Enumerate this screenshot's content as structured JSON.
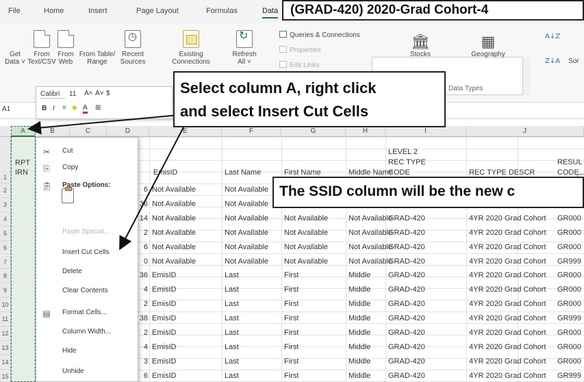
{
  "ribbon_tabs": [
    "File",
    "Home",
    "Insert",
    "Page Layout",
    "Formulas",
    "Data"
  ],
  "active_tab": "Data",
  "get_data": {
    "buttons": [
      {
        "line1": "Get",
        "line2": "Data ˅",
        "icon": "database-icon"
      },
      {
        "line1": "From",
        "line2": "Text/CSV",
        "icon": "text-file-icon"
      },
      {
        "line1": "From",
        "line2": "Web",
        "icon": "web-icon"
      },
      {
        "line1": "From Table/",
        "line2": "Range",
        "icon": "table-icon"
      },
      {
        "line1": "Recent",
        "line2": "Sources",
        "icon": "recent-icon"
      },
      {
        "line1": "Existing",
        "line2": "Connections",
        "icon": "connections-icon"
      }
    ]
  },
  "queries": {
    "refresh_line1": "Refresh",
    "refresh_line2": "All ˅",
    "queries_connections": "Queries & Connections",
    "properties": "Properties",
    "edit_links": "Edit Links"
  },
  "data_types": {
    "stocks": "Stocks",
    "geography": "Geography",
    "group_label": "Data Types"
  },
  "sort": {
    "label": "Sor",
    "az": "A↓Z",
    "za": "Z↓A"
  },
  "mini_toolbar": {
    "font": "Calibri",
    "size": "11",
    "grow": "A˄",
    "shrink": "A˅",
    "currency": "$",
    "bold": "B",
    "italic": "I",
    "align": "≡",
    "fill": "◆",
    "font_color": "A",
    "borders": "⊞"
  },
  "name_box": "A1",
  "column_letters": [
    "A",
    "B",
    "C",
    "D",
    "E",
    "F",
    "G",
    "H",
    "I",
    "J"
  ],
  "row_numbers": [
    "1",
    "2",
    "3",
    "4",
    "5",
    "6",
    "7",
    "8",
    "9",
    "10",
    "11",
    "12",
    "13",
    "14",
    "15"
  ],
  "header_row": {
    "a_line1": "RPT",
    "a_line2": "IRN",
    "d": "EmisID",
    "e": "Last Name",
    "f": "First Name",
    "g": "Middle Name",
    "h_line1": "LEVEL 2",
    "h_line2": "REC TYPE",
    "h_line3": "CODE",
    "i": "REC TYPE DESCR",
    "j_line1": "RESUL",
    "j_line2": "CODE"
  },
  "rows": [
    {
      "c": "6",
      "d": "Not Available",
      "e": "Not Available",
      "f": "",
      "g": "",
      "h": "",
      "i": "",
      "j": ""
    },
    {
      "c": "36",
      "d": "Not Available",
      "e": "Not Available",
      "f": "",
      "g": "",
      "h": "",
      "i": "",
      "j": ""
    },
    {
      "c": "14",
      "d": "Not Available",
      "e": "Not Available",
      "f": "Not Available",
      "g": "Not Available",
      "h": "GRAD-420",
      "i": "4YR 2020 Grad Cohort",
      "j": "GR000"
    },
    {
      "c": "2",
      "d": "Not Available",
      "e": "Not Available",
      "f": "Not Available",
      "g": "Not Available",
      "h": "GRAD-420",
      "i": "4YR 2020 Grad Cohort",
      "j": "GR000"
    },
    {
      "c": "6",
      "d": "Not Available",
      "e": "Not Available",
      "f": "Not Available",
      "g": "Not Available",
      "h": "GRAD-420",
      "i": "4YR 2020 Grad Cohort",
      "j": "GR000"
    },
    {
      "c": "0",
      "d": "Not Available",
      "e": "Not Available",
      "f": "Not Available",
      "g": "Not Available",
      "h": "GRAD-420",
      "i": "4YR 2020 Grad Cohort",
      "j": "GR999"
    },
    {
      "c": "36",
      "d": "EmisID",
      "e": "Last",
      "f": "First",
      "g": "Middle",
      "h": "GRAD-420",
      "i": "4YR 2020 Grad Cohort",
      "j": "GR000"
    },
    {
      "c": "4",
      "d": "EmisID",
      "e": "Last",
      "f": "First",
      "g": "Middle",
      "h": "GRAD-420",
      "i": "4YR 2020 Grad Cohort",
      "j": "GR000"
    },
    {
      "c": "2",
      "d": "EmisID",
      "e": "Last",
      "f": "First",
      "g": "Middle",
      "h": "GRAD-420",
      "i": "4YR 2020 Grad Cohort",
      "j": "GR000"
    },
    {
      "c": "38",
      "d": "EmisID",
      "e": "Last",
      "f": "First",
      "g": "Middle",
      "h": "GRAD-420",
      "i": "4YR 2020 Grad Cohort",
      "j": "GR999"
    },
    {
      "c": "2",
      "d": "EmisID",
      "e": "Last",
      "f": "First",
      "g": "Middle",
      "h": "GRAD-420",
      "i": "4YR 2020 Grad Cohort",
      "j": "GR000"
    },
    {
      "c": "4",
      "d": "EmisID",
      "e": "Last",
      "f": "First",
      "g": "Middle",
      "h": "GRAD-420",
      "i": "4YR 2020 Grad Cohort",
      "j": "GR000"
    },
    {
      "c": "3",
      "d": "EmisID",
      "e": "Last",
      "f": "First",
      "g": "Middle",
      "h": "GRAD-420",
      "i": "4YR 2020 Grad Cohort",
      "j": "GR000"
    },
    {
      "c": "6",
      "d": "EmisID",
      "e": "Last",
      "f": "First",
      "g": "Middle",
      "h": "GRAD-420",
      "i": "4YR 2020 Grad Cohort",
      "j": "GR999"
    }
  ],
  "context_menu": {
    "cut": "Cut",
    "copy": "Copy",
    "paste_options": "Paste Options:",
    "paste_special": "Paste Special...",
    "insert_cut_cells": "Insert Cut Cells",
    "delete": "Delete",
    "clear_contents": "Clear Contents",
    "format_cells": "Format Cells...",
    "column_width": "Column Width...",
    "hide": "Hide",
    "unhide": "Unhide"
  },
  "callouts": {
    "title": "(GRAD-420) 2020-Grad Cohort-4",
    "instruction_line1": "Select column A, right click",
    "instruction_line2": "and select Insert Cut Cells",
    "note": "The SSID column will be the new c"
  },
  "colors": {
    "excel_green": "#217346",
    "column_selected": "#e6efe6",
    "callout_border": "#222222"
  }
}
